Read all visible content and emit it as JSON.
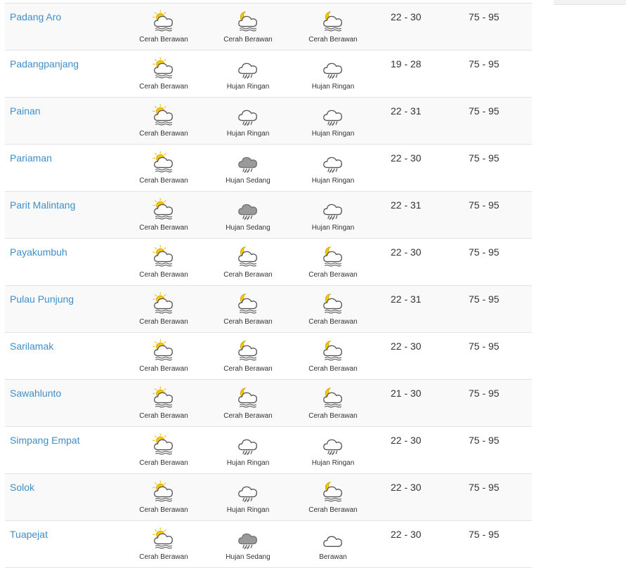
{
  "rows": [
    {
      "city": "Padang Aro",
      "w": [
        {
          "icon": "sun-cloud-fog-icon",
          "label": "Cerah Berawan"
        },
        {
          "icon": "moon-cloud-fog-icon",
          "label": "Cerah Berawan"
        },
        {
          "icon": "moon-cloud-fog-icon",
          "label": "Cerah Berawan"
        }
      ],
      "temp": "22 - 30",
      "hum": "75 - 95"
    },
    {
      "city": "Padangpanjang",
      "w": [
        {
          "icon": "sun-cloud-fog-icon",
          "label": "Cerah Berawan"
        },
        {
          "icon": "light-rain-icon",
          "label": "Hujan Ringan"
        },
        {
          "icon": "light-rain-icon",
          "label": "Hujan Ringan"
        }
      ],
      "temp": "19 - 28",
      "hum": "75 - 95"
    },
    {
      "city": "Painan",
      "w": [
        {
          "icon": "sun-cloud-fog-icon",
          "label": "Cerah Berawan"
        },
        {
          "icon": "light-rain-icon",
          "label": "Hujan Ringan"
        },
        {
          "icon": "light-rain-icon",
          "label": "Hujan Ringan"
        }
      ],
      "temp": "22 - 31",
      "hum": "75 - 95"
    },
    {
      "city": "Pariaman",
      "w": [
        {
          "icon": "sun-cloud-fog-icon",
          "label": "Cerah Berawan"
        },
        {
          "icon": "moderate-rain-icon",
          "label": "Hujan Sedang"
        },
        {
          "icon": "light-rain-icon",
          "label": "Hujan Ringan"
        }
      ],
      "temp": "22 - 30",
      "hum": "75 - 95"
    },
    {
      "city": "Parit Malintang",
      "w": [
        {
          "icon": "sun-cloud-fog-icon",
          "label": "Cerah Berawan"
        },
        {
          "icon": "moderate-rain-icon",
          "label": "Hujan Sedang"
        },
        {
          "icon": "light-rain-icon",
          "label": "Hujan Ringan"
        }
      ],
      "temp": "22 - 31",
      "hum": "75 - 95"
    },
    {
      "city": "Payakumbuh",
      "w": [
        {
          "icon": "sun-cloud-fog-icon",
          "label": "Cerah Berawan"
        },
        {
          "icon": "moon-cloud-fog-icon",
          "label": "Cerah Berawan"
        },
        {
          "icon": "moon-cloud-fog-icon",
          "label": "Cerah Berawan"
        }
      ],
      "temp": "22 - 30",
      "hum": "75 - 95"
    },
    {
      "city": "Pulau Punjung",
      "w": [
        {
          "icon": "sun-cloud-fog-icon",
          "label": "Cerah Berawan"
        },
        {
          "icon": "moon-cloud-fog-icon",
          "label": "Cerah Berawan"
        },
        {
          "icon": "moon-cloud-fog-icon",
          "label": "Cerah Berawan"
        }
      ],
      "temp": "22 - 31",
      "hum": "75 - 95"
    },
    {
      "city": "Sarilamak",
      "w": [
        {
          "icon": "sun-cloud-fog-icon",
          "label": "Cerah Berawan"
        },
        {
          "icon": "moon-cloud-fog-icon",
          "label": "Cerah Berawan"
        },
        {
          "icon": "moon-cloud-fog-icon",
          "label": "Cerah Berawan"
        }
      ],
      "temp": "22 - 30",
      "hum": "75 - 95"
    },
    {
      "city": "Sawahlunto",
      "w": [
        {
          "icon": "sun-cloud-fog-icon",
          "label": "Cerah Berawan"
        },
        {
          "icon": "moon-cloud-fog-icon",
          "label": "Cerah Berawan"
        },
        {
          "icon": "moon-cloud-fog-icon",
          "label": "Cerah Berawan"
        }
      ],
      "temp": "21 - 30",
      "hum": "75 - 95"
    },
    {
      "city": "Simpang Empat",
      "w": [
        {
          "icon": "sun-cloud-fog-icon",
          "label": "Cerah Berawan"
        },
        {
          "icon": "light-rain-icon",
          "label": "Hujan Ringan"
        },
        {
          "icon": "light-rain-icon",
          "label": "Hujan Ringan"
        }
      ],
      "temp": "22 - 30",
      "hum": "75 - 95"
    },
    {
      "city": "Solok",
      "w": [
        {
          "icon": "sun-cloud-fog-icon",
          "label": "Cerah Berawan"
        },
        {
          "icon": "light-rain-icon",
          "label": "Hujan Ringan"
        },
        {
          "icon": "moon-cloud-fog-icon",
          "label": "Cerah Berawan"
        }
      ],
      "temp": "22 - 30",
      "hum": "75 - 95"
    },
    {
      "city": "Tuapejat",
      "w": [
        {
          "icon": "sun-cloud-fog-icon",
          "label": "Cerah Berawan"
        },
        {
          "icon": "moderate-rain-icon",
          "label": "Hujan Sedang"
        },
        {
          "icon": "cloud-icon",
          "label": "Berawan"
        }
      ],
      "temp": "22 - 30",
      "hum": "75 - 95"
    }
  ],
  "colors": {
    "link": "#3f8fc8",
    "sun": "#f7c600",
    "cloud_outline": "#555555",
    "rain_cloud": "#9a9a9a"
  }
}
